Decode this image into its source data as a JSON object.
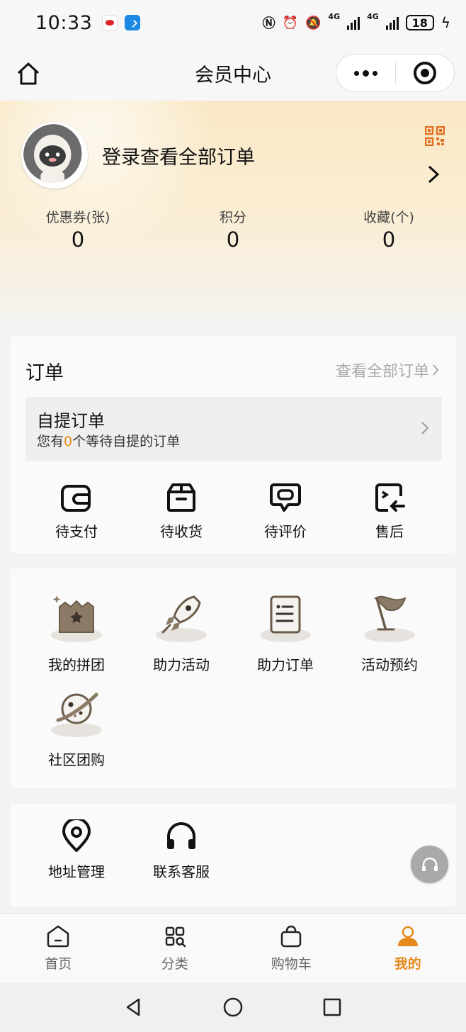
{
  "status_bar": {
    "time": "10:33",
    "battery": "18",
    "net1": "4G",
    "net2": "4G"
  },
  "nav": {
    "title": "会员中心"
  },
  "member": {
    "login_prompt": "登录查看全部订单",
    "stats": [
      {
        "label": "优惠券(张)",
        "value": "0"
      },
      {
        "label": "积分",
        "value": "0"
      },
      {
        "label": "收藏(个)",
        "value": "0"
      }
    ]
  },
  "orders": {
    "title": "订单",
    "view_all": "查看全部订单",
    "pickup": {
      "title": "自提订单",
      "sub_prefix": "您有",
      "count": "0",
      "sub_suffix": "个等待自提的订单"
    },
    "statuses": [
      {
        "label": "待支付",
        "icon": "wallet-icon"
      },
      {
        "label": "待收货",
        "icon": "box-icon"
      },
      {
        "label": "待评价",
        "icon": "comment-icon"
      },
      {
        "label": "售后",
        "icon": "return-icon"
      }
    ]
  },
  "features": [
    {
      "label": "我的拼团",
      "icon": "group-buy-icon"
    },
    {
      "label": "助力活动",
      "icon": "rocket-icon"
    },
    {
      "label": "助力订单",
      "icon": "document-icon"
    },
    {
      "label": "活动预约",
      "icon": "flag-icon"
    },
    {
      "label": "社区团购",
      "icon": "planet-icon"
    }
  ],
  "services": [
    {
      "label": "地址管理",
      "icon": "location-icon"
    },
    {
      "label": "联系客服",
      "icon": "headset-icon"
    }
  ],
  "tabs": [
    {
      "label": "首页",
      "icon": "home-icon",
      "active": false
    },
    {
      "label": "分类",
      "icon": "category-icon",
      "active": false
    },
    {
      "label": "购物车",
      "icon": "cart-icon",
      "active": false
    },
    {
      "label": "我的",
      "icon": "user-icon",
      "active": true
    }
  ],
  "colors": {
    "accent": "#e6891c",
    "header_gradient_top": "#f9e8c6",
    "illustration_brown": "#7d6a54"
  }
}
